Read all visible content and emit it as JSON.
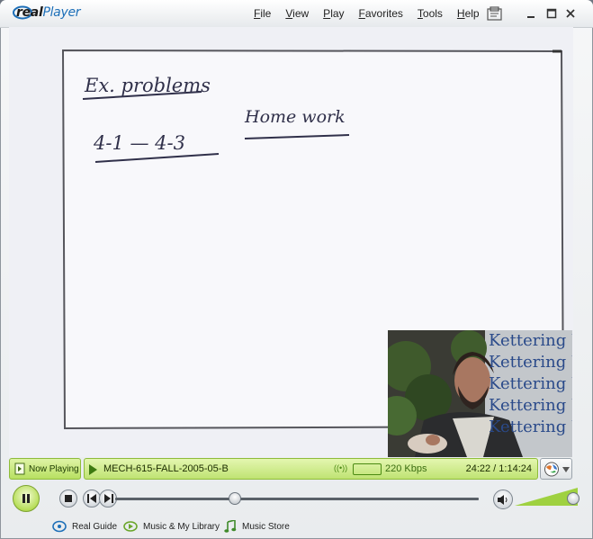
{
  "app": {
    "name_prefix": "real",
    "name_suffix": "Player"
  },
  "menu": [
    "File",
    "View",
    "Play",
    "Favorites",
    "Tools",
    "Help"
  ],
  "whiteboard": {
    "heading": "Ex. problems",
    "range": "4-1 — 4-3",
    "note": "Home work"
  },
  "pip_banner": [
    "Kettering U",
    "Kettering U",
    "Kettering U",
    "Kettering U",
    "Kettering U"
  ],
  "now_playing": {
    "label": "Now Playing",
    "clip_title": "MECH-615-FALL-2005-05-B",
    "bitrate": "220 Kbps",
    "time": "24:22 / 1:14:24"
  },
  "playback": {
    "position_fraction": 0.329,
    "volume_fraction": 1.0
  },
  "bottom_links": [
    "Real Guide",
    "Music & My Library",
    "Music Store"
  ],
  "colors": {
    "accent_green": "#b7e061",
    "clip_text": "#1b2b00",
    "brand_blue": "#1d6fb8"
  }
}
